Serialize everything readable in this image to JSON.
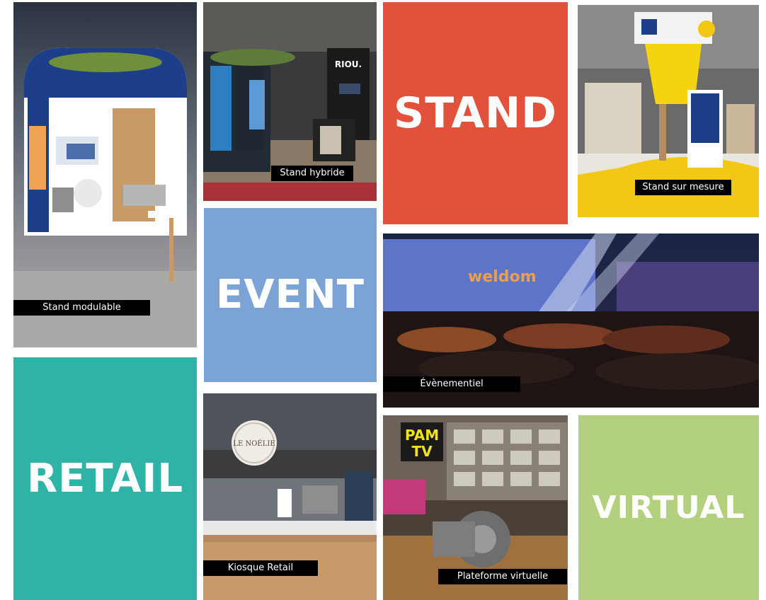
{
  "colors": {
    "stand": "#e2513c",
    "event": "#7ba3d6",
    "retail": "#2fb3a6",
    "virtual": "#b2d07e",
    "caption_bg": "#000000",
    "caption_text": "#ffffff"
  },
  "tiles": {
    "stand_word": "STAND",
    "event_word": "EVENT",
    "retail_word": "RETAIL",
    "virtual_word": "VIRTUAL"
  },
  "photos": {
    "modulable": {
      "caption": "Stand modulable",
      "icon": "modular-booth-photo"
    },
    "hybride": {
      "caption": "Stand hybride",
      "icon": "hybrid-booth-photo",
      "sign": "RIOU."
    },
    "mesure": {
      "caption": "Stand sur mesure",
      "icon": "custom-booth-photo"
    },
    "evenementiel": {
      "caption": "Évènementiel",
      "icon": "event-hall-photo",
      "screen_text": "weldom"
    },
    "kiosque": {
      "caption": "Kiosque Retail",
      "icon": "retail-kiosk-photo",
      "sign": "LE NOÉLIE"
    },
    "virtuelle": {
      "caption": "Plateforme virtuelle",
      "icon": "virtual-platform-photo",
      "sign_line1": "PAM",
      "sign_line2": "TV"
    }
  }
}
